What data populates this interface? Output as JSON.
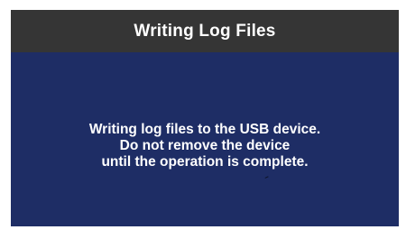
{
  "dialog": {
    "title": "Writing Log Files",
    "message_lines": [
      "Writing log files to the USB device.",
      "Do not remove the device",
      "until the operation is complete."
    ],
    "colors": {
      "titlebar_bg": "#353535",
      "body_bg": "#1e2d65",
      "text": "#ffffff"
    }
  }
}
